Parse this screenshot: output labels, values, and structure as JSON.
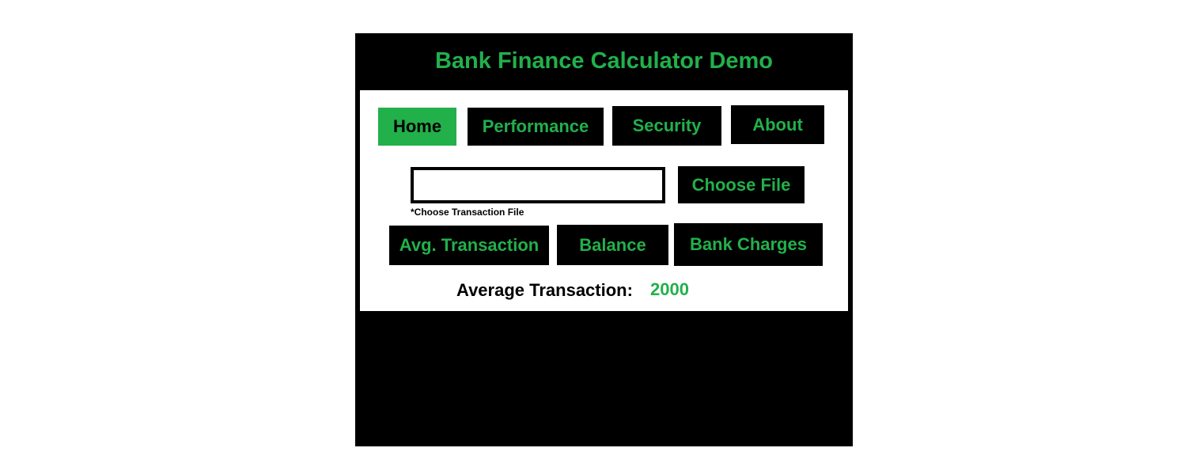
{
  "header": {
    "title": "Bank Finance Calculator Demo"
  },
  "nav": {
    "items": [
      {
        "label": "Home",
        "active": true
      },
      {
        "label": "Performance",
        "active": false
      },
      {
        "label": "Security",
        "active": false
      },
      {
        "label": "About",
        "active": false
      }
    ]
  },
  "file": {
    "value": "",
    "choose_label": "Choose File",
    "hint": "*Choose Transaction File"
  },
  "actions": {
    "avg_label": "Avg. Transaction",
    "balance_label": "Balance",
    "charges_label": "Bank Charges"
  },
  "result": {
    "label": "Average Transaction:",
    "value": "2000"
  },
  "colors": {
    "accent": "#22b04b",
    "background": "#000000",
    "panel": "#ffffff"
  }
}
